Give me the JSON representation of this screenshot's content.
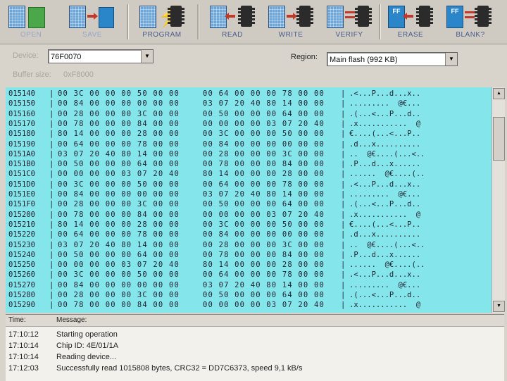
{
  "toolbar": {
    "buttons": [
      {
        "label": "OPEN"
      },
      {
        "label": "SAVE"
      },
      {
        "label": "PROGRAM"
      },
      {
        "label": "READ"
      },
      {
        "label": "WRITE"
      },
      {
        "label": "VERIFY"
      },
      {
        "label": "ERASE"
      },
      {
        "label": "BLANK?"
      }
    ],
    "ff_text": "FF"
  },
  "device": {
    "label": "Device:",
    "value": "76F0070",
    "buffer_label": "Buffer size:",
    "buffer_value": "0xF8000"
  },
  "region": {
    "label": "Region:",
    "value": "Main flash (992 KB)"
  },
  "hex_rows": [
    {
      "addr": "015140",
      "b1": "00 3C 00 00 00 50 00 00",
      "b2": "00 64 00 00 00 78 00 00",
      "ascii": ".<...P...d...x.."
    },
    {
      "addr": "015150",
      "b1": "00 84 00 00 00 00 00 00",
      "b2": "03 07 20 40 80 14 00 00",
      "ascii": ".........  @€..."
    },
    {
      "addr": "015160",
      "b1": "00 28 00 00 00 3C 00 00",
      "b2": "00 50 00 00 00 64 00 00",
      "ascii": ".(...<...P...d.."
    },
    {
      "addr": "015170",
      "b1": "00 78 00 00 00 84 00 00",
      "b2": "00 00 00 00 03 07 20 40",
      "ascii": ".x...........  @"
    },
    {
      "addr": "015180",
      "b1": "80 14 00 00 00 28 00 00",
      "b2": "00 3C 00 00 00 50 00 00",
      "ascii": "€....(...<...P.."
    },
    {
      "addr": "015190",
      "b1": "00 64 00 00 00 78 00 00",
      "b2": "00 84 00 00 00 00 00 00",
      "ascii": ".d...x.........."
    },
    {
      "addr": "0151A0",
      "b1": "03 07 20 40 80 14 00 00",
      "b2": "00 28 00 00 00 3C 00 00",
      "ascii": "..  @€....(...<.."
    },
    {
      "addr": "0151B0",
      "b1": "00 50 00 00 00 64 00 00",
      "b2": "00 78 00 00 00 84 00 00",
      "ascii": ".P...d...x......"
    },
    {
      "addr": "0151C0",
      "b1": "00 00 00 00 03 07 20 40",
      "b2": "80 14 00 00 00 28 00 00",
      "ascii": "......  @€....(.."
    },
    {
      "addr": "0151D0",
      "b1": "00 3C 00 00 00 50 00 00",
      "b2": "00 64 00 00 00 78 00 00",
      "ascii": ".<...P...d...x.."
    },
    {
      "addr": "0151E0",
      "b1": "00 84 00 00 00 00 00 00",
      "b2": "03 07 20 40 80 14 00 00",
      "ascii": ".........  @€..."
    },
    {
      "addr": "0151F0",
      "b1": "00 28 00 00 00 3C 00 00",
      "b2": "00 50 00 00 00 64 00 00",
      "ascii": ".(...<...P...d.."
    },
    {
      "addr": "015200",
      "b1": "00 78 00 00 00 84 00 00",
      "b2": "00 00 00 00 03 07 20 40",
      "ascii": ".x...........  @"
    },
    {
      "addr": "015210",
      "b1": "80 14 00 00 00 28 00 00",
      "b2": "00 3C 00 00 00 50 00 00",
      "ascii": "€....(...<...P.."
    },
    {
      "addr": "015220",
      "b1": "00 64 00 00 00 78 00 00",
      "b2": "00 84 00 00 00 00 00 00",
      "ascii": ".d...x.........."
    },
    {
      "addr": "015230",
      "b1": "03 07 20 40 80 14 00 00",
      "b2": "00 28 00 00 00 3C 00 00",
      "ascii": "..  @€....(...<.."
    },
    {
      "addr": "015240",
      "b1": "00 50 00 00 00 64 00 00",
      "b2": "00 78 00 00 00 84 00 00",
      "ascii": ".P...d...x......"
    },
    {
      "addr": "015250",
      "b1": "00 00 00 00 03 07 20 40",
      "b2": "80 14 00 00 00 28 00 00",
      "ascii": "......  @€....(.."
    },
    {
      "addr": "015260",
      "b1": "00 3C 00 00 00 50 00 00",
      "b2": "00 64 00 00 00 78 00 00",
      "ascii": ".<...P...d...x.."
    },
    {
      "addr": "015270",
      "b1": "00 84 00 00 00 00 00 00",
      "b2": "03 07 20 40 80 14 00 00",
      "ascii": ".........  @€..."
    },
    {
      "addr": "015280",
      "b1": "00 28 00 00 00 3C 00 00",
      "b2": "00 50 00 00 00 64 00 00",
      "ascii": ".(...<...P...d.."
    },
    {
      "addr": "015290",
      "b1": "00 78 00 00 00 84 00 00",
      "b2": "00 00 00 00 03 07 20 40",
      "ascii": ".x...........  @"
    }
  ],
  "log": {
    "col_time": "Time:",
    "col_message": "Message:",
    "rows": [
      {
        "time": "17:10:12",
        "message": "Starting operation"
      },
      {
        "time": "17:10:14",
        "message": "Chip ID: 4E/01/1A"
      },
      {
        "time": "17:10:14",
        "message": "Reading device..."
      },
      {
        "time": "17:12:03",
        "message": "Successfully read 1015808 bytes, CRC32 = DD7C6373, speed 9,1 kB/s"
      }
    ]
  },
  "colors": {
    "hex_background": "#84e6ea",
    "toolbar_label": "#4a5a8a",
    "arrow": "#c0392b"
  }
}
